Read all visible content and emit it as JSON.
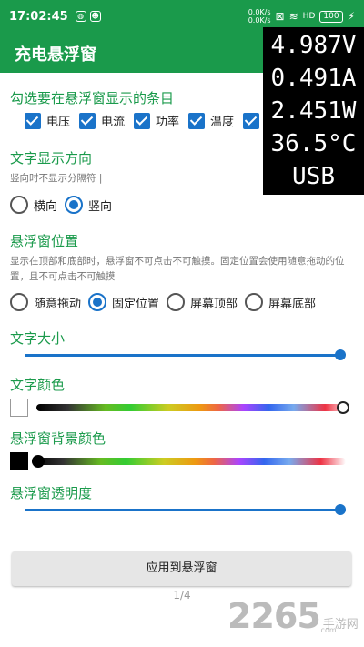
{
  "status": {
    "time": "17:02:45",
    "net_up": "0.0K/s",
    "net_down": "0.0K/s",
    "battery": "100"
  },
  "app": {
    "title": "充电悬浮窗"
  },
  "overlay": {
    "lines": [
      "4.987V",
      "0.491A",
      "2.451W",
      "36.5°C",
      "USB"
    ]
  },
  "items_section": {
    "title": "勾选要在悬浮窗显示的条目",
    "checkboxes": [
      {
        "label": "电压",
        "checked": true
      },
      {
        "label": "电流",
        "checked": true
      },
      {
        "label": "功率",
        "checked": true
      },
      {
        "label": "温度",
        "checked": true
      },
      {
        "label": "",
        "checked": true
      }
    ]
  },
  "direction_section": {
    "title": "文字显示方向",
    "hint": "竖向时不显示分隔符 |",
    "options": [
      {
        "label": "横向",
        "selected": false
      },
      {
        "label": "竖向",
        "selected": true
      }
    ]
  },
  "position_section": {
    "title": "悬浮窗位置",
    "hint": "显示在顶部和底部时，悬浮窗不可点击不可触摸。固定位置会使用随意拖动的位置，且不可点击不可触摸",
    "options": [
      {
        "label": "随意拖动",
        "selected": false
      },
      {
        "label": "固定位置",
        "selected": true
      },
      {
        "label": "屏幕顶部",
        "selected": false
      },
      {
        "label": "屏幕底部",
        "selected": false
      }
    ]
  },
  "text_size": {
    "title": "文字大小",
    "value": 1.0
  },
  "text_color": {
    "title": "文字颜色",
    "swatch": "#ffffff",
    "value": 1.0
  },
  "bg_color": {
    "title": "悬浮窗背景颜色",
    "swatch": "#000000",
    "value": 0.0
  },
  "opacity": {
    "title": "悬浮窗透明度",
    "value": 1.0
  },
  "apply_button": "应用到悬浮窗",
  "page_indicator": "1/4",
  "watermark": {
    "number": "2265",
    "text": "手游网",
    "sub": ".com"
  },
  "colors": {
    "primary": "#1a9a4b",
    "accent": "#1a73c9"
  }
}
